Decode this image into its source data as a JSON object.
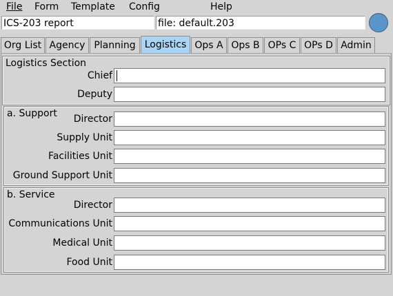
{
  "menu": {
    "file": "File",
    "form": "Form",
    "template": "Template",
    "config": "Config",
    "help": "Help"
  },
  "header": {
    "report_name": "ICS-203 report",
    "file_label": "file: default.203"
  },
  "tabs": [
    "Org List",
    "Agency",
    "Planning",
    "Logistics",
    "Ops A",
    "Ops B",
    "OPs C",
    "OPs D",
    "Admin"
  ],
  "active_tab": "Logistics",
  "logistics": {
    "section_title": "Logistics Section",
    "chief_label": "Chief",
    "chief_value": "",
    "deputy_label": "Deputy",
    "deputy_value": "",
    "support": {
      "title": "a. Support",
      "director_label": "Director",
      "director_value": "",
      "supply_label": "Supply Unit",
      "supply_value": "",
      "facilities_label": "Facilities Unit",
      "facilities_value": "",
      "ground_label": "Ground Support Unit",
      "ground_value": ""
    },
    "service": {
      "title": "b. Service",
      "director_label": "Director",
      "director_value": "",
      "communications_label": "Communications Unit",
      "communications_value": "",
      "medical_label": "Medical Unit",
      "medical_value": "",
      "food_label": "Food Unit",
      "food_value": ""
    }
  },
  "colors": {
    "background": "#d4d4d4",
    "active_tab": "#a9d4f3",
    "status_indicator": "#5b95c9"
  }
}
